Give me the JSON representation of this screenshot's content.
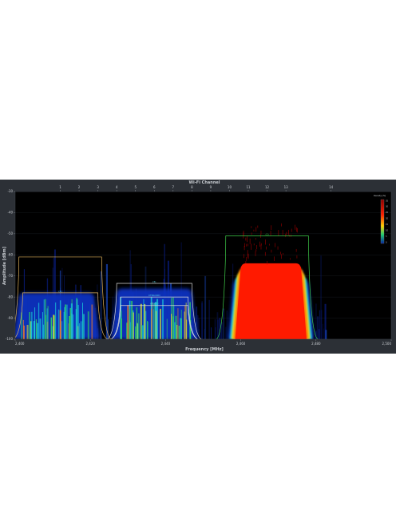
{
  "app": {
    "top_axis_title": "Wi-Fi Channel",
    "x_axis_title": "Frequency [MHz]",
    "y_axis_title": "Amplitude [dBm]",
    "legend_title": "Density [%]"
  },
  "colors": {
    "background": "#2c3036",
    "plot_background": "#000000",
    "signal_low": "#0a2a9a",
    "signal_mid": "#22c9a0",
    "signal_high": "#ff1a00",
    "mask_orange": "#e1b25a",
    "mask_white": "#d8d8d8",
    "mask_green": "#3fcf4a"
  },
  "chart_data": {
    "type": "heatmap",
    "x_range": [
      2400,
      2500
    ],
    "y_range": [
      -100,
      -30
    ],
    "x_ticks": [
      "2,400",
      "2,420",
      "2,440",
      "2,460",
      "2,480",
      "2,500"
    ],
    "y_ticks": [
      "-30",
      "-40",
      "-50",
      "-60",
      "-70",
      "-80",
      "-90",
      "-100"
    ],
    "channel_ticks": [
      {
        "label": "1",
        "freq": 2412
      },
      {
        "label": "2",
        "freq": 2417
      },
      {
        "label": "3",
        "freq": 2422
      },
      {
        "label": "4",
        "freq": 2427
      },
      {
        "label": "5",
        "freq": 2432
      },
      {
        "label": "6",
        "freq": 2437
      },
      {
        "label": "7",
        "freq": 2442
      },
      {
        "label": "8",
        "freq": 2447
      },
      {
        "label": "9",
        "freq": 2452
      },
      {
        "label": "10",
        "freq": 2457
      },
      {
        "label": "11",
        "freq": 2462
      },
      {
        "label": "12",
        "freq": 2467
      },
      {
        "label": "13",
        "freq": 2472
      },
      {
        "label": "14",
        "freq": 2484
      }
    ],
    "legend_ticks": [
      "35",
      "30",
      "25",
      "20",
      "15",
      "10",
      "5",
      "0"
    ],
    "signals": [
      {
        "center": 2411,
        "top": -78,
        "width": 20
      },
      {
        "center": 2437,
        "top": -76,
        "width": 20
      },
      {
        "center": 2468,
        "top": -72,
        "width": 20
      }
    ],
    "masks": [
      {
        "label": "",
        "center": 2412,
        "top": -61,
        "width": 22,
        "color": "#e1b25a"
      },
      {
        "label": "(2)",
        "center": 2412,
        "top": -78,
        "width": 20,
        "color": "#e1b25a"
      },
      {
        "label": "(3)",
        "center": 2437,
        "top": -73.5,
        "width": 20,
        "color": "#d8d8d8"
      },
      {
        "label": "CTRLOOD",
        "center": 2437,
        "top": -80,
        "width": 18,
        "color": "#d8d8d8"
      },
      {
        "label": "WEB02",
        "center": 2437,
        "top": -84,
        "width": 18,
        "color": "#d8d8d8"
      },
      {
        "label": "(1)",
        "center": 2467,
        "top": -51,
        "width": 22,
        "color": "#3fcf4a"
      }
    ]
  }
}
